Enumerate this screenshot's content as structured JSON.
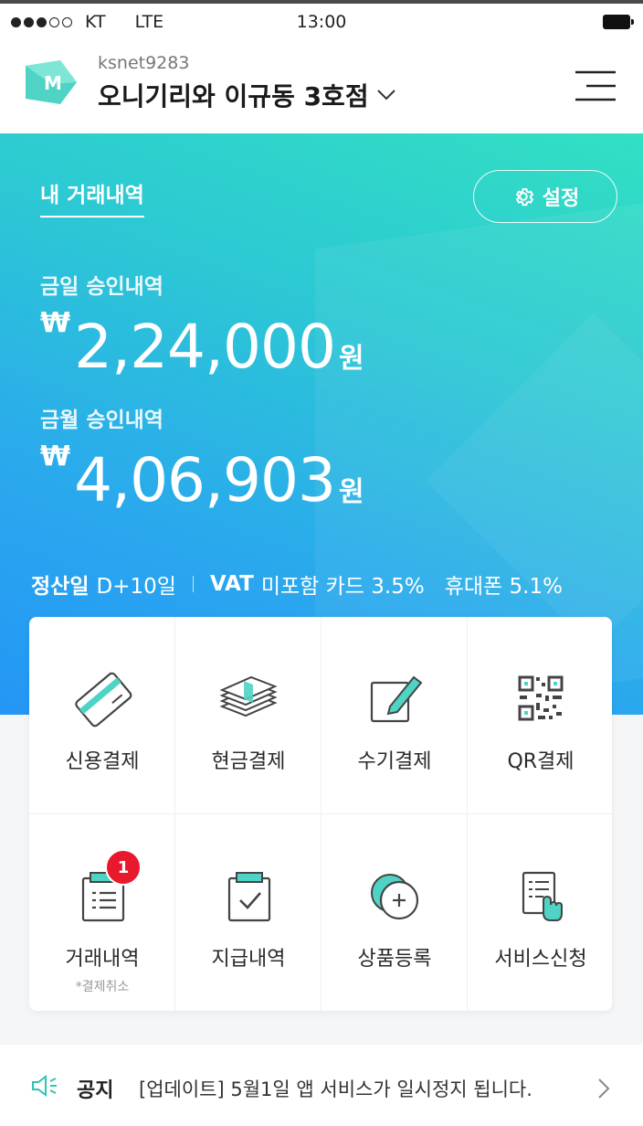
{
  "status_bar": {
    "carrier": "KT",
    "network": "LTE",
    "time": "13:00"
  },
  "header": {
    "account_id": "ksnet9283",
    "store_name": "오니기리와 이규동 3호점",
    "logo_letter": "M"
  },
  "hero": {
    "tab_label": "내 거래내역",
    "settings_label": "설정",
    "today_label": "금일 승인내역",
    "today_currency": "₩",
    "today_amount": "2,24,000",
    "today_unit": "원",
    "month_label": "금월 승인내역",
    "month_currency": "₩",
    "month_amount": "4,06,903",
    "month_unit": "원",
    "settlement_label": "정산일",
    "settlement_value": "D+10일",
    "vat_label": "VAT",
    "vat_value": "미포함 카드 3.5%",
    "phone_value": "휴대폰 5.1%"
  },
  "menu": [
    {
      "label": "신용결제",
      "icon": "credit-card-icon"
    },
    {
      "label": "현금결제",
      "icon": "cash-stack-icon"
    },
    {
      "label": "수기결제",
      "icon": "pencil-edit-icon"
    },
    {
      "label": "QR결제",
      "icon": "qr-code-icon"
    },
    {
      "label": "거래내역",
      "sub": "*결제취소",
      "badge": "1",
      "icon": "clipboard-list-icon"
    },
    {
      "label": "지급내역",
      "icon": "clipboard-check-icon"
    },
    {
      "label": "상품등록",
      "icon": "add-product-icon"
    },
    {
      "label": "서비스신청",
      "icon": "document-tap-icon"
    }
  ],
  "notice": {
    "label": "공지",
    "text": "[업데이트] 5월1일 앱 서비스가 일시정지 됩니다."
  },
  "colors": {
    "accent": "#4fd3c4",
    "gradient_start": "#32e0c2",
    "gradient_end": "#2496f5",
    "badge": "#e8192c"
  }
}
